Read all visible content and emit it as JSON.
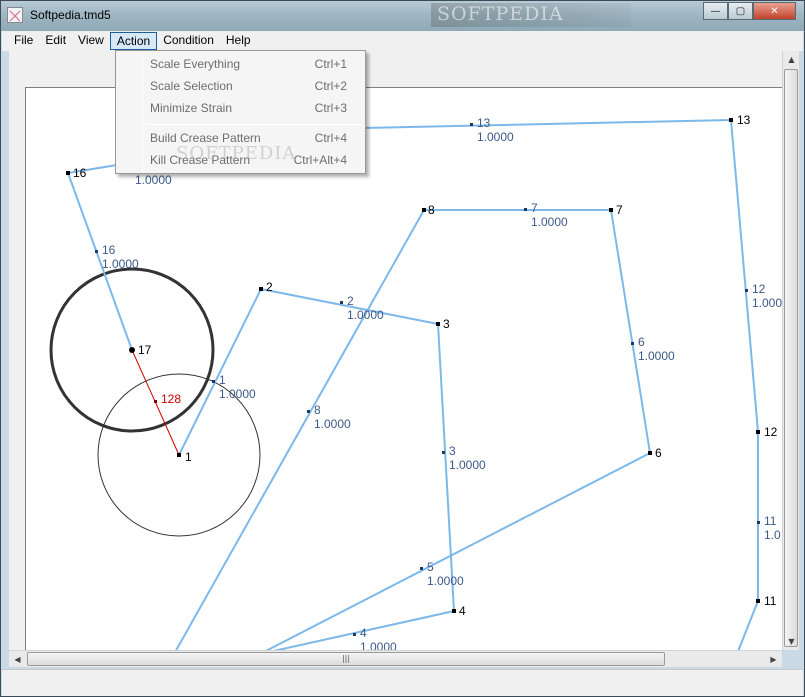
{
  "window": {
    "title": "Softpedia.tmd5",
    "watermark": "SOFTPEDIA",
    "buttons": {
      "minimize": "—",
      "maximize": "▢",
      "close": "✕"
    }
  },
  "menubar": {
    "items": [
      "File",
      "Edit",
      "View",
      "Action",
      "Condition",
      "Help"
    ],
    "active": "Action"
  },
  "action_menu": {
    "items": [
      {
        "label": "Scale Everything",
        "shortcut": "Ctrl+1"
      },
      {
        "label": "Scale Selection",
        "shortcut": "Ctrl+2"
      },
      {
        "label": "Minimize Strain",
        "shortcut": "Ctrl+3"
      },
      {
        "label": "Build Crease Pattern",
        "shortcut": "Ctrl+4"
      },
      {
        "label": "Kill Crease Pattern",
        "shortcut": "Ctrl+Alt+4"
      }
    ],
    "watermark": "SOFTPEDIA"
  },
  "tree": {
    "colors": {
      "edge": "#7cb8ea",
      "node": "#000000",
      "edge_label": "#3a5a8a",
      "path": "#cc0000",
      "circle": "#333333"
    },
    "nodes": [
      {
        "id": "1",
        "label": "1"
      },
      {
        "id": "2",
        "label": "2"
      },
      {
        "id": "3",
        "label": "3"
      },
      {
        "id": "4",
        "label": "4"
      },
      {
        "id": "6",
        "label": "6"
      },
      {
        "id": "7",
        "label": "7"
      },
      {
        "id": "8",
        "label": "8"
      },
      {
        "id": "11",
        "label": "11"
      },
      {
        "id": "12",
        "label": "12"
      },
      {
        "id": "13",
        "label": "13"
      },
      {
        "id": "16",
        "label": "16"
      },
      {
        "id": "17",
        "label": "17"
      }
    ],
    "edge_labels": [
      {
        "id": "1",
        "length": "1.0000"
      },
      {
        "id": "2",
        "length": "1.0000"
      },
      {
        "id": "3",
        "length": "1.0000"
      },
      {
        "id": "4",
        "length": "1.0000"
      },
      {
        "id": "5",
        "length": "1.0000"
      },
      {
        "id": "6",
        "length": "1.0000"
      },
      {
        "id": "7",
        "length": "1.0000"
      },
      {
        "id": "8",
        "length": "1.0000"
      },
      {
        "id": "11",
        "length": "1.0"
      },
      {
        "id": "12",
        "length": "1.000"
      },
      {
        "id": "13",
        "length": "1.0000"
      },
      {
        "id": "16",
        "length": "1.0000"
      },
      {
        "id": "17",
        "length": "1.0000"
      }
    ],
    "path_label": "128"
  }
}
